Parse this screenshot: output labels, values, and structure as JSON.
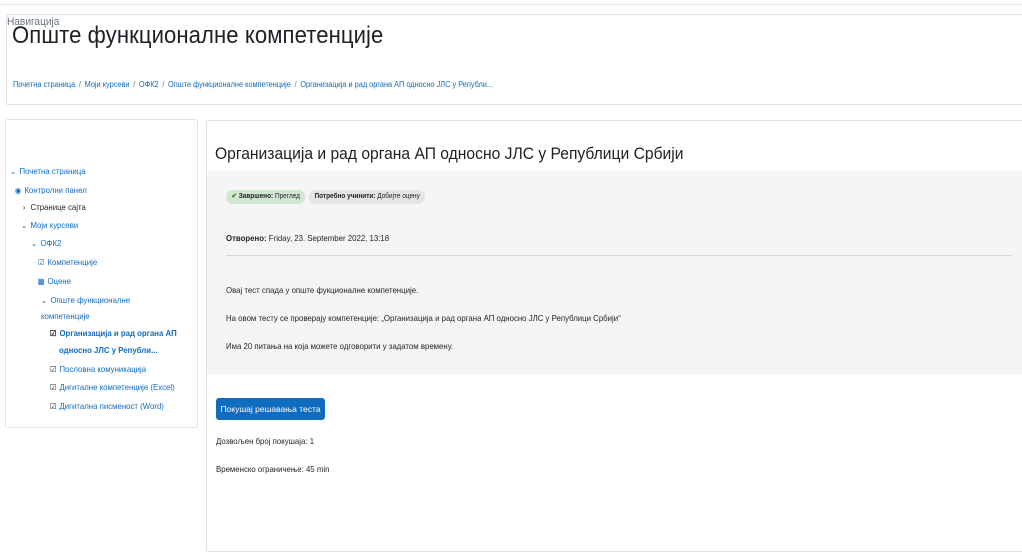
{
  "page": {
    "title": "Опште функционалне компетенције",
    "breadcrumb": [
      "Почетна страница",
      "Моји курсеви",
      "ОФК2",
      "Опште функционалне компетенције",
      "Организација и рад органа АП односно ЈЛС у Републи..."
    ],
    "separator": "/"
  },
  "nav": {
    "title": "Навигација",
    "items": {
      "home": "Почетна страница",
      "dashboard": "Контролни панел",
      "site_pages": "Странице сајта",
      "my_courses": "Моји курсеви",
      "course": "ОФК2",
      "competencies": "Компетенције",
      "grades": "Оцене",
      "section_line1": "Опште функционалне",
      "section_line2": "компетенције",
      "current_line1": "Организација и рад органа АП",
      "current_line2": "односно ЈЛС у Републи...",
      "business_comm": "Пословна комуникација",
      "digital_excel": "Дигиталне компетенције (Excel)",
      "digital_word": "Дигитална писменост (Word)"
    },
    "icons": {
      "expanded": "chevron-down-icon",
      "collapsed": "chevron-right-icon",
      "dashboard": "dashboard-icon",
      "checkbox": "checkbox-icon",
      "table": "table-icon",
      "quiz": "quiz-icon"
    }
  },
  "activity": {
    "title": "Организација и рад органа АП односно ЈЛС у Републици Србији",
    "completion": {
      "done_label": "Завршено:",
      "done_value": "Преглед",
      "todo_label": "Потребно учинити:",
      "todo_value": "Добијте оцену"
    },
    "opened_label": "Отворено:",
    "opened_value": "Friday, 23. September 2022, 13:18",
    "description": [
      "Овај тест спада у опште фукционалне компетенције.",
      "На овом тесту се проверају компетенције: „Организација и рад органа АП односно ЈЛС у Републици Србији“",
      "Има 20 питања на која можете одговорити у задатом времену."
    ],
    "attempt_button": "Покушај решавања теста",
    "attempts_allowed": "Дозвољен број покушаја: 1",
    "time_limit": "Временско ограничење: 45 min"
  },
  "colors": {
    "link": "#0f6cbf",
    "primary_button": "#0f6cbf",
    "panel_bg": "#f5f5f5",
    "done_badge": "#d2e7d2",
    "badge_bg": "#e5e5e5"
  }
}
